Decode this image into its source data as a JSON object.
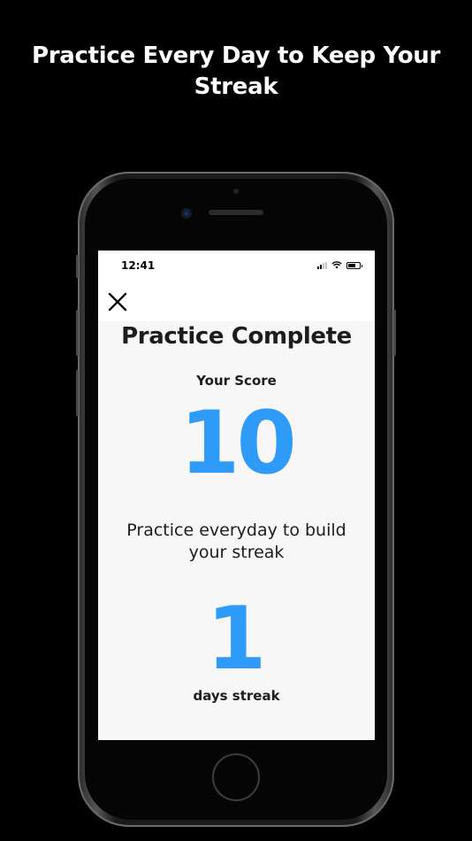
{
  "headline": "Practice Every Day to Keep Your Streak",
  "status_bar": {
    "time": "12:41",
    "icons": [
      "signal-icon",
      "wifi-icon",
      "battery-icon"
    ]
  },
  "screen": {
    "close_icon": "close-icon",
    "title": "Practice Complete",
    "score_label": "Your Score",
    "score_value": "10",
    "message": "Practice everyday to build your streak",
    "streak_value": "1",
    "streak_label": "days streak"
  },
  "colors": {
    "accent": "#2f9bf8",
    "background": "#000000",
    "screen_background": "#f7f7f7",
    "text": "#1d1d1d"
  }
}
